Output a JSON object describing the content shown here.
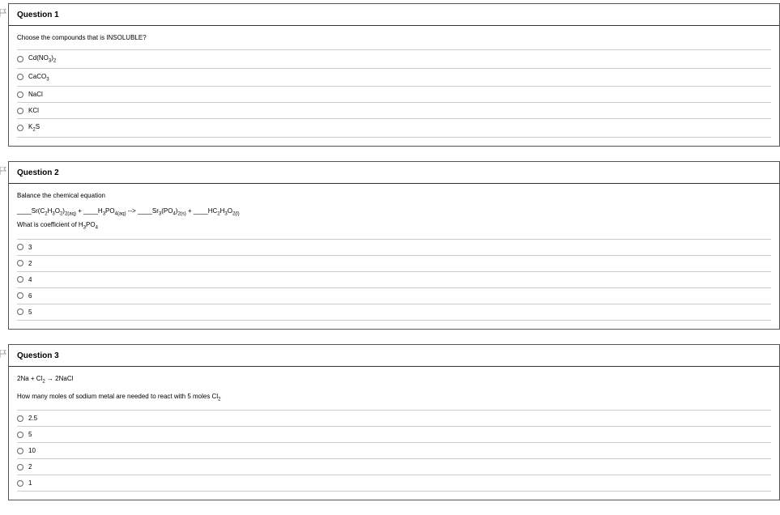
{
  "questions": [
    {
      "title": "Question 1",
      "prompt": "Choose the compounds that is INSOLUBLE?",
      "options": [
        {
          "html": "Cd(NO<sub>3</sub>)<sub>2</sub>"
        },
        {
          "html": "CaCO<sub>3</sub>"
        },
        {
          "html": "NaCl"
        },
        {
          "html": "KCl"
        },
        {
          "html": "K<sub>2</sub>S"
        }
      ]
    },
    {
      "title": "Question 2",
      "prompt": "Balance the chemical equation",
      "equation": "____Sr(C<sub>2</sub>H<sub>3</sub>O<sub>2</sub>)<sub>2(aq)</sub> + ____H<sub>3</sub>PO<sub>4(aq)</sub> --> ____Sr<sub>3</sub>(PO<sub>4</sub>)<sub>2(s)</sub> + ____HC<sub>2</sub>H<sub>3</sub>O<sub>2(l)</sub>",
      "prompt2": "What is coefficient of H<sub>3</sub>PO<sub>4</sub>",
      "options": [
        {
          "html": "3"
        },
        {
          "html": "2"
        },
        {
          "html": "4"
        },
        {
          "html": "6"
        },
        {
          "html": "5"
        }
      ]
    },
    {
      "title": "Question 3",
      "prompt": "2Na + Cl<sub>2</sub> → 2NaCl",
      "prompt2": "How many moles of sodium metal are needed to react with 5 moles Cl<sub>2</sub>",
      "options": [
        {
          "html": "2.5"
        },
        {
          "html": "5"
        },
        {
          "html": "10"
        },
        {
          "html": "2"
        },
        {
          "html": "1"
        }
      ]
    }
  ]
}
